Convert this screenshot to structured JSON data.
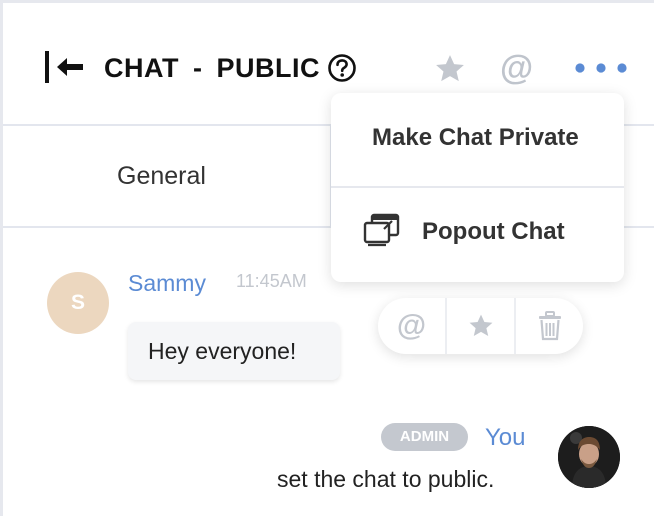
{
  "header": {
    "title_left": "CHAT",
    "title_separator": "-",
    "title_right": "PUBLIC"
  },
  "tabs": [
    {
      "label": "General"
    }
  ],
  "dropdown": {
    "make_private_label": "Make Chat Private",
    "popout_label": "Popout Chat"
  },
  "messages": [
    {
      "avatar_letter": "S",
      "sender": "Sammy",
      "time": "11:45AM",
      "text": "Hey everyone!"
    },
    {
      "badge": "ADMIN",
      "sender": "You",
      "text": "set the chat to public."
    }
  ],
  "message_actions": {
    "mention_symbol": "@"
  },
  "colors": {
    "accent_blue": "#5b8bd4",
    "muted_gray": "#c3c7ce",
    "avatar_peach": "#ecd7bf"
  },
  "icons": {
    "collapse": "collapse-left-icon",
    "help": "question-circle-icon",
    "star": "star-icon",
    "mention": "at-icon",
    "more": "more-dots-icon",
    "popout": "popout-window-icon",
    "delete": "trash-icon"
  }
}
